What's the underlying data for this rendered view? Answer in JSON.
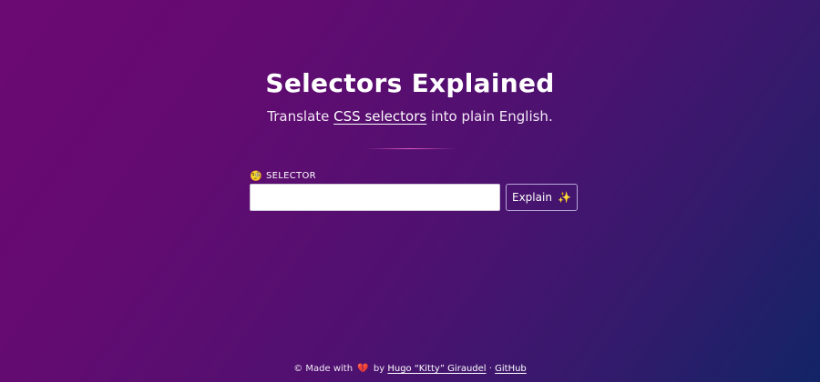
{
  "header": {
    "title": "Selectors Explained",
    "subtitle_before": "Translate ",
    "subtitle_link": "CSS selectors",
    "subtitle_after": " into plain English."
  },
  "form": {
    "label_emoji": "🧐",
    "label": "SELECTOR",
    "input_value": "",
    "input_placeholder": "",
    "button_label": "Explain",
    "button_emoji": "✨"
  },
  "footer": {
    "copyright": "©",
    "made_with": "Made with",
    "heart_emoji": "💔",
    "by": "by",
    "author": "Hugo “Kitty” Giraudel",
    "separator": "·",
    "github": "GitHub"
  },
  "colors": {
    "background_start": "#6b0a72",
    "background_end": "#122466",
    "divider": "#ff6ed2",
    "button_border": "#b8a8d8"
  }
}
